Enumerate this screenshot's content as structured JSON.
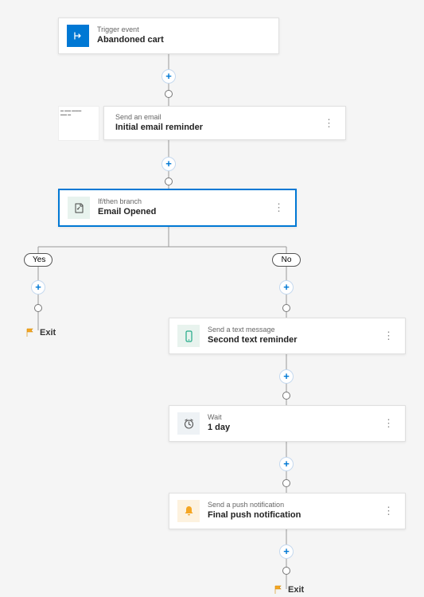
{
  "trigger": {
    "type": "Trigger event",
    "title": "Abandoned cart"
  },
  "email": {
    "type": "Send an email",
    "title": "Initial email reminder"
  },
  "branch": {
    "type": "If/then branch",
    "title": "Email Opened",
    "yes": "Yes",
    "no": "No"
  },
  "sms": {
    "type": "Send a text message",
    "title": "Second text reminder"
  },
  "wait": {
    "type": "Wait",
    "title": "1 day"
  },
  "push": {
    "type": "Send a push notification",
    "title": "Final push notification"
  },
  "exit": "Exit"
}
